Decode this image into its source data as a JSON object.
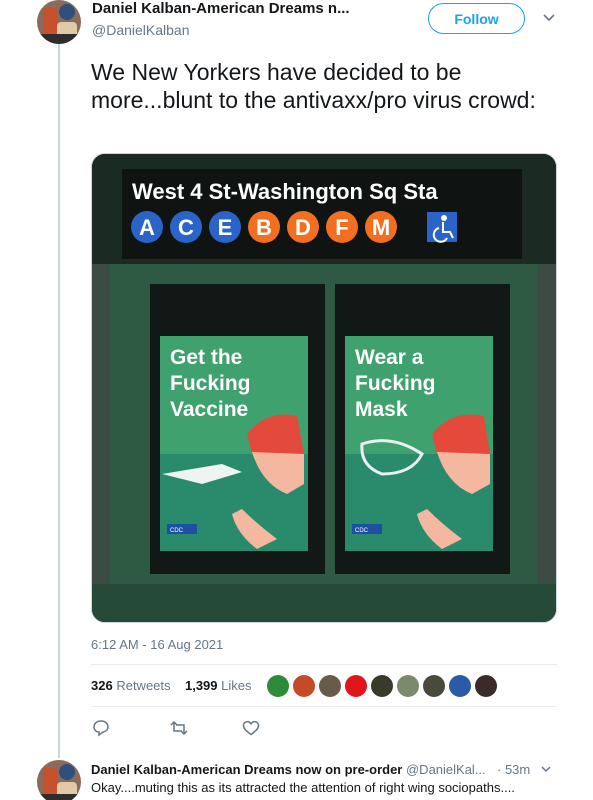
{
  "tweet": {
    "author_name": "Daniel Kalban-American Dreams n...",
    "author_handle": "@DanielKalban",
    "follow_label": "Follow",
    "text": "We New Yorkers have decided to be more...blunt to the antivaxx/pro virus crowd:",
    "timestamp": "6:12 AM - 16 Aug 2021",
    "retweets_count": "326",
    "retweets_label": "Retweets",
    "likes_count": "1,399",
    "likes_label": "Likes"
  },
  "media": {
    "station_sign": "West 4 St-Washington Sq Sta",
    "lines": [
      {
        "letter": "A",
        "color": "#2a64c8"
      },
      {
        "letter": "C",
        "color": "#2a64c8"
      },
      {
        "letter": "E",
        "color": "#2a64c8"
      },
      {
        "letter": "B",
        "color": "#f26f21"
      },
      {
        "letter": "D",
        "color": "#f26f21"
      },
      {
        "letter": "F",
        "color": "#f26f21"
      },
      {
        "letter": "M",
        "color": "#f26f21"
      }
    ],
    "poster_left": [
      "Get the",
      "Fucking",
      "Vaccine"
    ],
    "poster_right": [
      "Wear a",
      "Fucking",
      "Mask"
    ],
    "poster_badge": "CDC"
  },
  "likers": [
    "#2e8b3a",
    "#c44a2a",
    "#6a5a4a",
    "#e0161b",
    "#3a3a2a",
    "#7a8a6a",
    "#4a4a3a",
    "#2a5aa8",
    "#3a2a2a"
  ],
  "reply": {
    "name": "Daniel Kalban-American Dreams now on pre-order",
    "handle": "@DanielKal...",
    "time": "· 53m",
    "text": "Okay....muting this as its attracted the attention of right wing sociopaths...."
  },
  "icons": {
    "caret": "chevron-down-icon",
    "reply": "reply-icon",
    "retweet": "retweet-icon",
    "like": "heart-icon"
  }
}
